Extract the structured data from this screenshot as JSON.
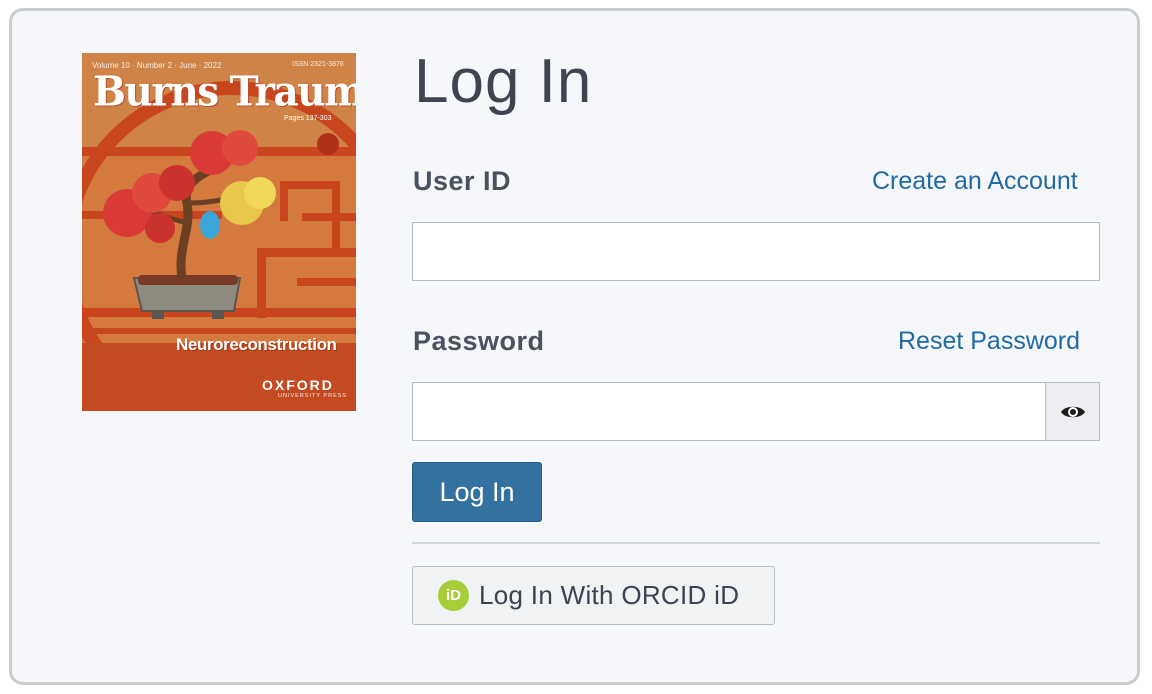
{
  "cover": {
    "meta": "Volume 10 · Number 2 · June · 2022",
    "issn": "ISSN 2321-3876",
    "title": "Burns Trauma",
    "pages": "Pages 137-303",
    "feature": "Neuroreconstruction",
    "publisher": "OXFORD",
    "publisher_sub": "UNIVERSITY PRESS",
    "colors": {
      "background": "#d86a32",
      "frame": "#c9451d"
    }
  },
  "form": {
    "heading": "Log In",
    "user_id_label": "User ID",
    "create_account_link": "Create an Account",
    "user_id_value": "",
    "password_label": "Password",
    "reset_password_link": "Reset Password",
    "password_value": "",
    "show_password_icon": "eye-icon",
    "submit_label": "Log In",
    "orcid_icon_text": "iD",
    "orcid_label": "Log In With ORCID iD"
  },
  "colors": {
    "link": "#1f6aa5",
    "primary_button": "#33719e",
    "orcid_green": "#a6ce39",
    "card_background": "#f5f7fa"
  }
}
